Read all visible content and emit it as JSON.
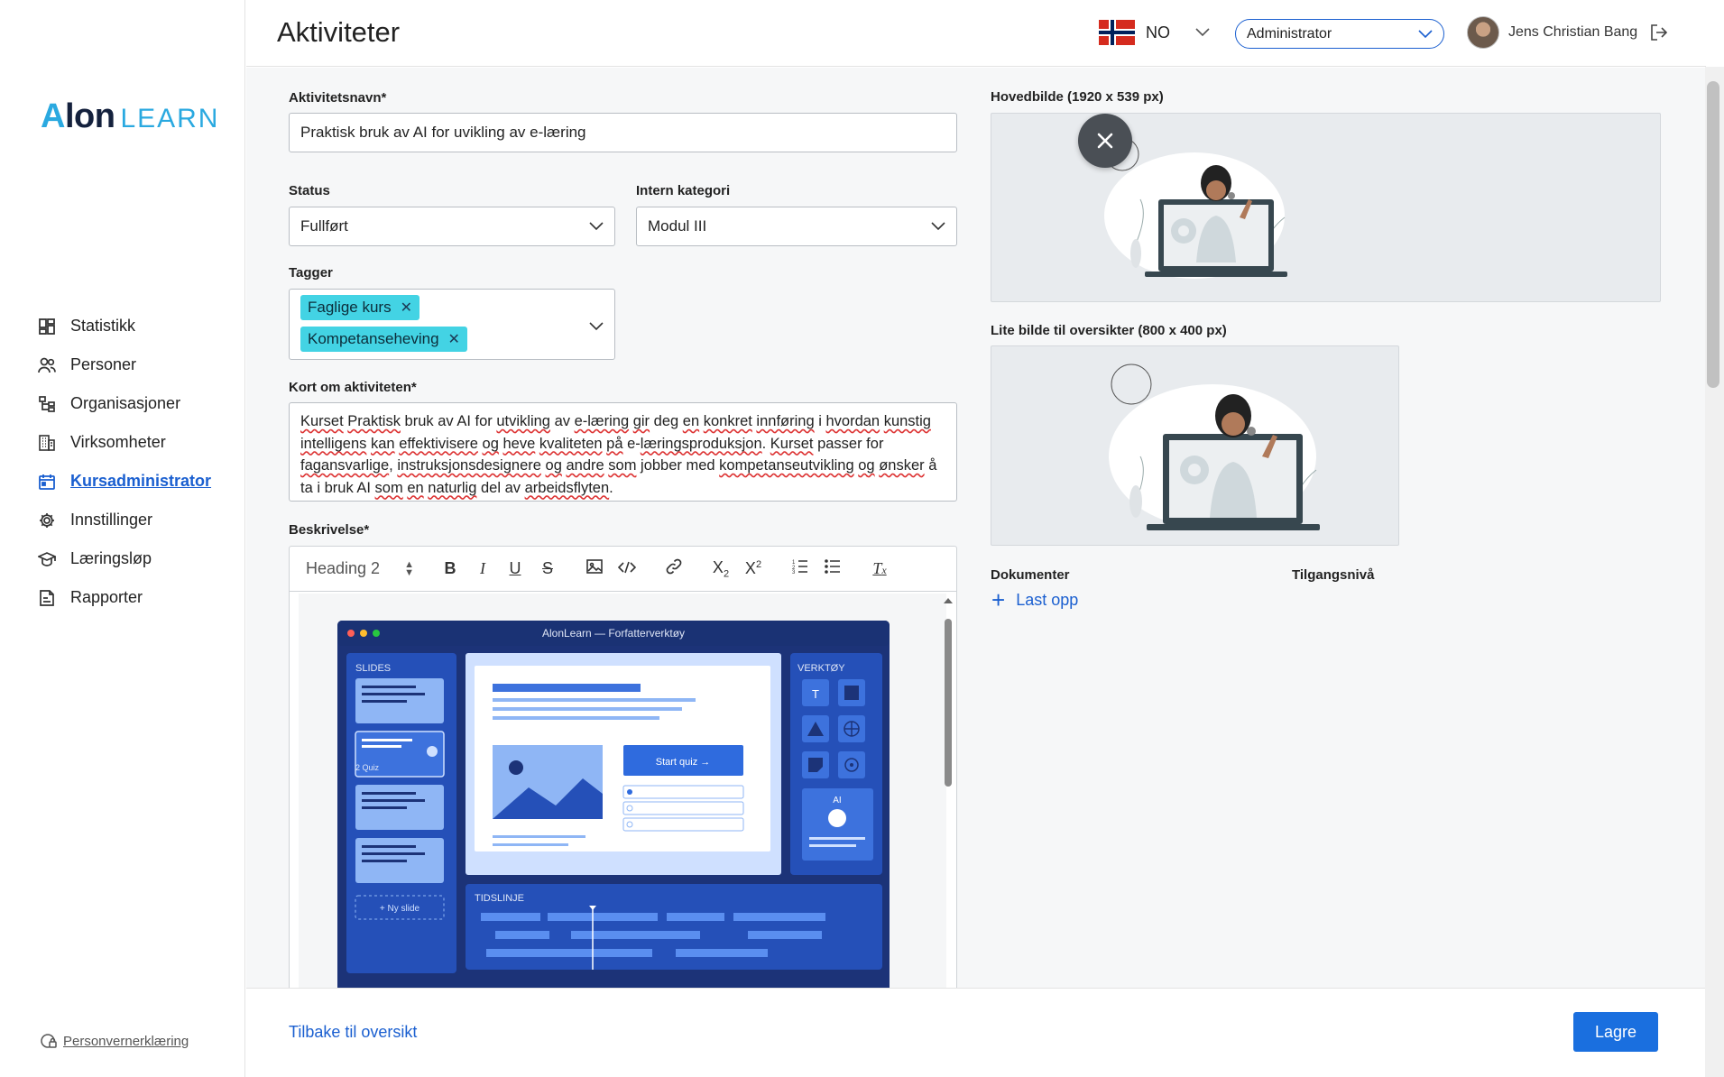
{
  "brand": {
    "logo_a": "A",
    "logo_lon": "lon",
    "logo_learn": "LEARN"
  },
  "sidebar": {
    "items": [
      {
        "label": "Statistikk",
        "icon": "dashboard-icon"
      },
      {
        "label": "Personer",
        "icon": "people-icon"
      },
      {
        "label": "Organisasjoner",
        "icon": "org-chart-icon"
      },
      {
        "label": "Virksomheter",
        "icon": "building-icon"
      },
      {
        "label": "Kursadministrator",
        "icon": "calendar-icon",
        "active": true
      },
      {
        "label": "Innstillinger",
        "icon": "gear-icon"
      },
      {
        "label": "Læringsløp",
        "icon": "graduation-cap-icon"
      },
      {
        "label": "Rapporter",
        "icon": "report-icon"
      }
    ],
    "privacy_label": "Personvernerklæring"
  },
  "header": {
    "title": "Aktiviteter",
    "language": "NO",
    "role": "Administrator",
    "user_name": "Jens Christian Bang"
  },
  "form": {
    "name_label": "Aktivitetsnavn*",
    "name_value": "Praktisk bruk av AI for uvikling av e-læring",
    "status_label": "Status",
    "status_value": "Fullført",
    "category_label": "Intern kategori",
    "category_value": "Modul III",
    "tags_label": "Tagger",
    "tags": [
      "Faglige kurs",
      "Kompetanseheving"
    ],
    "summary_label": "Kort om aktiviteten*",
    "summary_words": [
      "Kurset",
      " ",
      "Praktisk",
      " bruk av AI for ",
      "utvikling",
      " av ",
      "e-læring",
      " ",
      "gir",
      " deg ",
      "en",
      " ",
      "konkret",
      " ",
      "innføring",
      " i ",
      "hvordan",
      " ",
      "kunstig",
      " ",
      "intelligens",
      " ",
      "kan",
      " ",
      "effektivisere",
      " ",
      "og",
      " ",
      "heve",
      " ",
      "kvaliteten",
      " ",
      "på",
      " e-",
      "læringsproduksjon",
      ". ",
      "Kurset",
      " passer for ",
      "fagansvarlige",
      ", ",
      "instruksjonsdesignere",
      " ",
      "og",
      " ",
      "andre",
      " ",
      "som",
      " jobber med ",
      "kompetanseutvikling",
      " ",
      "og",
      " ",
      "ønsker",
      " å ta i bruk AI ",
      "som",
      " ",
      "en",
      " ",
      "naturlig",
      " del av ",
      "arbeidsflyten",
      "."
    ],
    "description_label": "Beskrivelse*",
    "heading_select": "Heading 2"
  },
  "editor_image": {
    "window_title": "AlonLearn — Forfatterverktøy",
    "slides_label": "SLIDES",
    "slide2_label": "2  Quiz",
    "new_slide": "+ Ny slide",
    "tools_label": "VERKTØY",
    "tool_t": "T",
    "ai_label": "AI",
    "start_quiz": "Start quiz →",
    "timeline_label": "TIDSLINJE"
  },
  "media": {
    "main_image_label": "Hovedbilde (1920 x 539 px)",
    "small_image_label": "Lite bilde til oversikter (800 x 400 px)",
    "documents_label": "Dokumenter",
    "access_label": "Tilgangsnivå",
    "upload_label": "Last opp"
  },
  "footer": {
    "back_label": "Tilbake til oversikt",
    "save_label": "Lagre"
  },
  "colors": {
    "accent": "#1a6fdf",
    "tag": "#43d3e4",
    "editor_dark": "#1c3378"
  }
}
